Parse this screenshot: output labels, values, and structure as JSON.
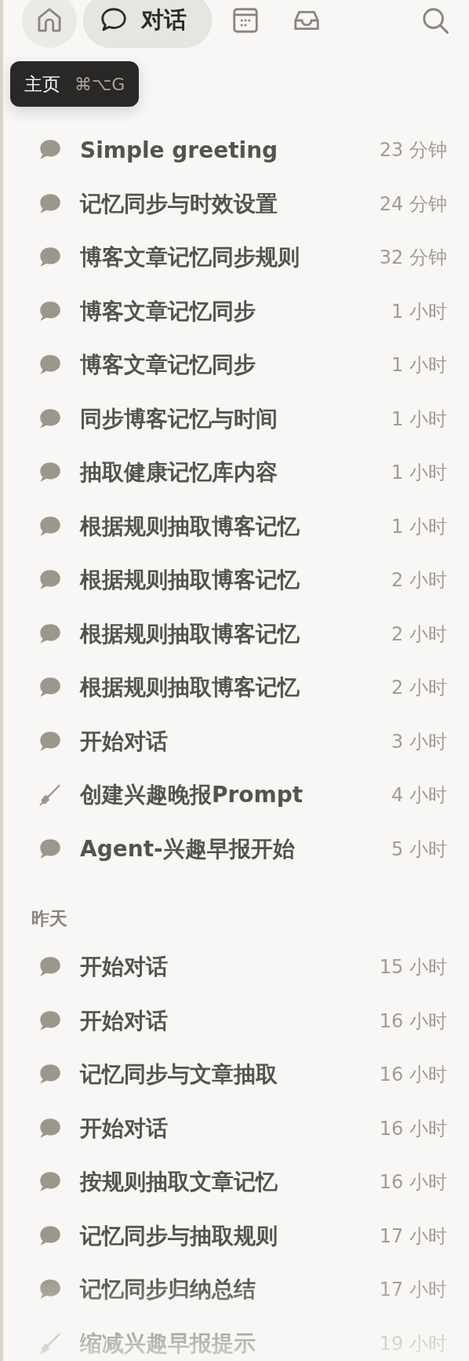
{
  "toolbar": {
    "tabs": [
      {
        "kind": "home",
        "selected": false,
        "hovered": true
      },
      {
        "kind": "chat",
        "label": "对话",
        "selected": true,
        "hovered": false
      },
      {
        "kind": "calendar",
        "selected": false,
        "hovered": false
      },
      {
        "kind": "inbox",
        "selected": false,
        "hovered": false
      }
    ]
  },
  "tooltip": {
    "label": "主页",
    "shortcut": "⌘⌥G"
  },
  "sections": [
    {
      "items": [
        {
          "kind": "chat",
          "title": "Simple greeting",
          "time": "23 分钟"
        },
        {
          "kind": "chat",
          "title": "记忆同步与时效设置",
          "time": "24 分钟"
        },
        {
          "kind": "chat",
          "title": "博客文章记忆同步规则",
          "time": "32 分钟"
        },
        {
          "kind": "chat",
          "title": "博客文章记忆同步",
          "time": "1 小时"
        },
        {
          "kind": "chat",
          "title": "博客文章记忆同步",
          "time": "1 小时"
        },
        {
          "kind": "chat",
          "title": "同步博客记忆与时间",
          "time": "1 小时"
        },
        {
          "kind": "chat",
          "title": "抽取健康记忆库内容",
          "time": "1 小时"
        },
        {
          "kind": "chat",
          "title": "根据规则抽取博客记忆",
          "time": "1 小时"
        },
        {
          "kind": "chat",
          "title": "根据规则抽取博客记忆",
          "time": "2 小时"
        },
        {
          "kind": "chat",
          "title": "根据规则抽取博客记忆",
          "time": "2 小时"
        },
        {
          "kind": "chat",
          "title": "根据规则抽取博客记忆",
          "time": "2 小时"
        },
        {
          "kind": "chat",
          "title": "开始对话",
          "time": "3 小时"
        },
        {
          "kind": "pen",
          "title": "创建兴趣晚报Prompt",
          "time": "4 小时"
        },
        {
          "kind": "chat",
          "title": "Agent-兴趣早报开始",
          "time": "5 小时"
        }
      ]
    },
    {
      "title": "昨天",
      "items": [
        {
          "kind": "chat",
          "title": "开始对话",
          "time": "15 小时"
        },
        {
          "kind": "chat",
          "title": "开始对话",
          "time": "16 小时"
        },
        {
          "kind": "chat",
          "title": "记忆同步与文章抽取",
          "time": "16 小时"
        },
        {
          "kind": "chat",
          "title": "开始对话",
          "time": "16 小时"
        },
        {
          "kind": "chat",
          "title": "按规则抽取文章记忆",
          "time": "16 小时"
        },
        {
          "kind": "chat",
          "title": "记忆同步与抽取规则",
          "time": "17 小时"
        },
        {
          "kind": "chat",
          "title": "记忆同步归纳总结",
          "time": "17 小时"
        },
        {
          "kind": "pen",
          "title": "缩减兴趣早报提示",
          "time": "19 小时"
        }
      ]
    }
  ]
}
